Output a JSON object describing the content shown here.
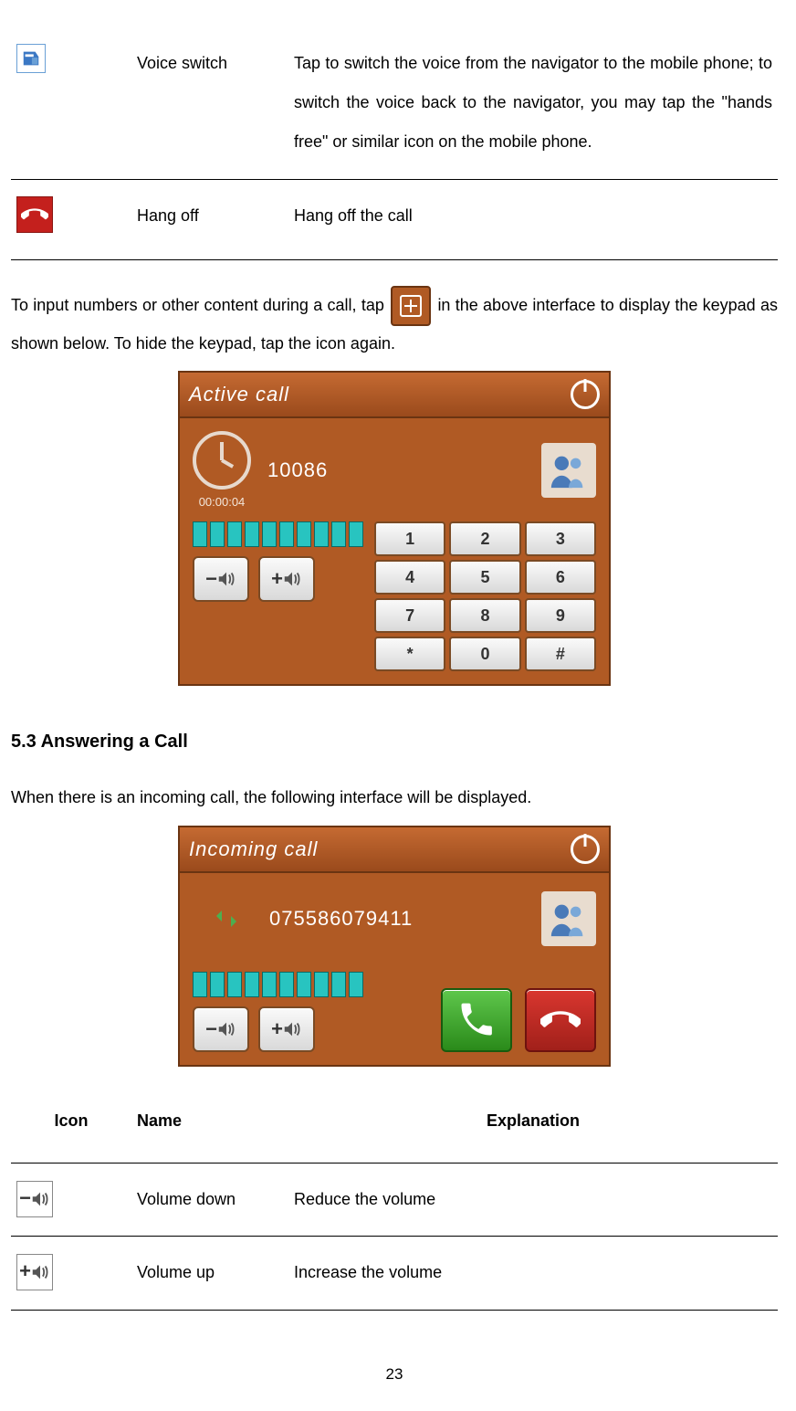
{
  "top_table": [
    {
      "name": "Voice switch",
      "desc": "Tap to switch the voice from the navigator to the mobile phone; to switch the voice back to the navigator, you may tap the \"hands free\" or similar icon on the mobile phone."
    },
    {
      "name": "Hang off",
      "desc": "Hang off the call"
    }
  ],
  "keypad_para_before": "To input numbers or other content during a call, tap ",
  "keypad_para_after": " in the above interface to display the keypad as shown below. To hide the keypad, tap the icon again.",
  "active_call": {
    "title": "Active call",
    "number": "10086",
    "timer": "00:00:04",
    "keys": [
      "1",
      "2",
      "3",
      "4",
      "5",
      "6",
      "7",
      "8",
      "9",
      "*",
      "0",
      "#"
    ]
  },
  "section_heading": "5.3 Answering a Call",
  "section_para": "When there is an incoming call, the following interface will be displayed.",
  "incoming_call": {
    "title": "Incoming call",
    "number": "075586079411"
  },
  "bottom_header": {
    "c1": "Icon",
    "c2": "Name",
    "c3": "Explanation"
  },
  "bottom_table": [
    {
      "name": "Volume down",
      "desc": "Reduce the volume"
    },
    {
      "name": "Volume up",
      "desc": "Increase the volume"
    }
  ],
  "page_number": "23"
}
